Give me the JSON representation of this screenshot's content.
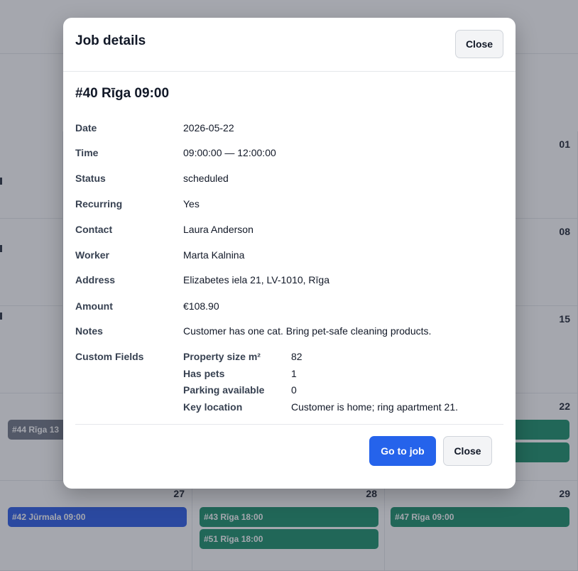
{
  "calendar": {
    "cells": [
      {
        "day": "01"
      },
      {
        "day": "08"
      },
      {
        "day": "15"
      },
      {
        "day": "22"
      },
      {
        "day": "27"
      },
      {
        "day": "28"
      },
      {
        "day": "29"
      }
    ],
    "events": {
      "e44": "#44 Rīga 13",
      "e42": "#42 Jūrmala 09:00",
      "e43": "#43 Rīga 18:00",
      "e51": "#51 Rīga 18:00",
      "e47": "#47 Rīga 09:00"
    }
  },
  "modal": {
    "title": "Job details",
    "close_top_label": "Close",
    "job_title": "#40 Rīga 09:00",
    "fields": {
      "date": {
        "label": "Date",
        "value": "2026-05-22"
      },
      "time": {
        "label": "Time",
        "value": "09:00:00 — 12:00:00"
      },
      "status": {
        "label": "Status",
        "value": "scheduled"
      },
      "recurring": {
        "label": "Recurring",
        "value": "Yes"
      },
      "contact": {
        "label": "Contact",
        "value": "Laura Anderson"
      },
      "worker": {
        "label": "Worker",
        "value": "Marta Kalnina"
      },
      "address": {
        "label": "Address",
        "value": "Elizabetes iela 21, LV-1010, Rīga"
      },
      "amount": {
        "label": "Amount",
        "value": "€108.90"
      },
      "notes": {
        "label": "Notes",
        "value": "Customer has one cat. Bring pet-safe cleaning products."
      }
    },
    "custom_fields": {
      "label": "Custom Fields",
      "items": [
        {
          "name": "Property size m²",
          "value": "82"
        },
        {
          "name": "Has pets",
          "value": "1"
        },
        {
          "name": "Parking available",
          "value": "0"
        },
        {
          "name": "Key location",
          "value": "Customer is home; ring apartment 21."
        }
      ]
    },
    "go_to_job_label": "Go to job",
    "close_bottom_label": "Close"
  },
  "colors": {
    "primary": "#2563eb",
    "event_green": "#0f8a63",
    "event_blue": "#2155e6",
    "event_gray": "#6b7280"
  }
}
